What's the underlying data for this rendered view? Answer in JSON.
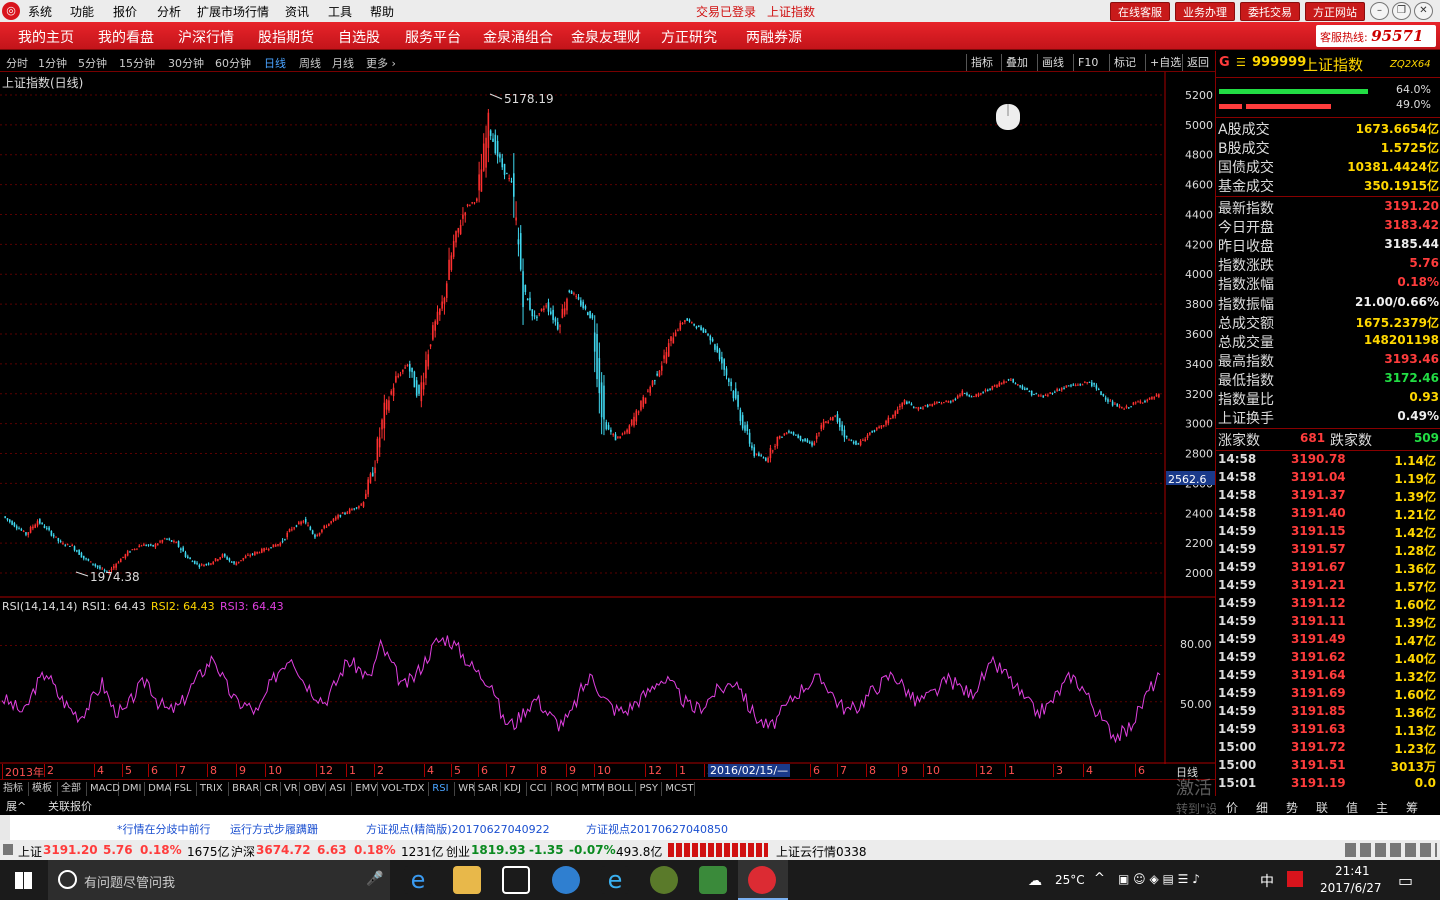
{
  "menubar": {
    "items": [
      "系统",
      "功能",
      "报价",
      "分析",
      "扩展市场行情",
      "资讯",
      "工具",
      "帮助"
    ],
    "status1": "交易已登录",
    "status2": "上证指数",
    "buttons": [
      "在线客服",
      "业务办理",
      "委托交易",
      "方正网站"
    ]
  },
  "navbar": {
    "items": [
      "我的主页",
      "我的看盘",
      "沪深行情",
      "股指期货",
      "自选股",
      "服务平台",
      "金泉涌组合",
      "金泉友理财",
      "方正研究",
      "两融券源"
    ],
    "hotline_label": "客服热线:",
    "hotline_number": "95571"
  },
  "periods": {
    "items": [
      "分时",
      "1分钟",
      "5分钟",
      "15分钟",
      "30分钟",
      "60分钟",
      "日线",
      "周线",
      "月线",
      "更多 ›"
    ],
    "active": "日线"
  },
  "right_tools": [
    "指标",
    "叠加",
    "画线",
    "F10",
    "标记",
    "+自选",
    "返回"
  ],
  "main_chart": {
    "title": "上证指数(日线)",
    "high_label": "5178.19",
    "low_label": "1974.38",
    "y_ticks": [
      "5200",
      "5000",
      "4800",
      "4600",
      "4400",
      "4200",
      "4000",
      "3800",
      "3600",
      "3400",
      "3200",
      "3000",
      "2800",
      "2600",
      "2400",
      "2200",
      "2000"
    ],
    "cursor_value": "2562.6"
  },
  "rsi": {
    "label": "RSI(14,14,14)",
    "rsi1": "RSI1: 64.43",
    "rsi2": "RSI2: 64.43",
    "rsi3": "RSI3: 64.43",
    "ticks": [
      "80.00",
      "50.00"
    ]
  },
  "time_axis": {
    "labels": [
      "2013年",
      "2",
      "4",
      "5",
      "6",
      "7",
      "8",
      "9",
      "10",
      "12",
      "1",
      "2",
      "4",
      "5",
      "6",
      "7",
      "8",
      "9",
      "10",
      "12",
      "1",
      "2",
      "6",
      "7",
      "8",
      "9",
      "10",
      "12",
      "1",
      "3",
      "4",
      "6"
    ],
    "cursor": "2016/02/15/—",
    "right": "日线"
  },
  "indicators": {
    "items": [
      "指标",
      "模板",
      "全部",
      "MACD",
      "DMI",
      "DMA",
      "FSL",
      "TRIX",
      "BRAR",
      "CR",
      "VR",
      "OBV",
      "ASI",
      "EMV",
      "VOL-TDX",
      "RSI",
      "WR",
      "SAR",
      "KDJ",
      "CCI",
      "ROC",
      "MTM",
      "BOLL",
      "PSY",
      "MCST"
    ],
    "active": "RSI",
    "tabs": [
      "展^",
      "关联报价"
    ]
  },
  "panel": {
    "code": "999999",
    "name": "上证指数",
    "tag": "ZQ2X64",
    "bar1_pct": "64.0%",
    "bar2_pct": "49.0%",
    "rows1": [
      {
        "k": "A股成交",
        "v": "1673.6654亿"
      },
      {
        "k": "B股成交",
        "v": "1.5725亿"
      },
      {
        "k": "国债成交",
        "v": "10381.4424亿"
      },
      {
        "k": "基金成交",
        "v": "350.1915亿"
      }
    ],
    "rows2": [
      {
        "k": "最新指数",
        "v": "3191.20",
        "c": "red"
      },
      {
        "k": "今日开盘",
        "v": "3183.42",
        "c": "red"
      },
      {
        "k": "昨日收盘",
        "v": "3185.44",
        "c": "white"
      },
      {
        "k": "指数涨跌",
        "v": "5.76",
        "c": "red"
      },
      {
        "k": "指数涨幅",
        "v": "0.18%",
        "c": "red"
      },
      {
        "k": "指数振幅",
        "v": "21.00/0.66%",
        "c": "white"
      },
      {
        "k": "总成交额",
        "v": "1675.2379亿",
        "c": "yellow"
      },
      {
        "k": "总成交量",
        "v": "148201198",
        "c": "yellow"
      },
      {
        "k": "最高指数",
        "v": "3193.46",
        "c": "red"
      },
      {
        "k": "最低指数",
        "v": "3172.46",
        "c": "green"
      },
      {
        "k": "指数量比",
        "v": "0.93",
        "c": "yellow"
      },
      {
        "k": "上证换手",
        "v": "0.49%",
        "c": "white"
      }
    ],
    "up_label": "涨家数",
    "up": "681",
    "down_label": "跌家数",
    "down": "509",
    "ticks": [
      [
        "14:58",
        "3190.78",
        "1.14亿"
      ],
      [
        "14:58",
        "3191.04",
        "1.19亿"
      ],
      [
        "14:58",
        "3191.37",
        "1.39亿"
      ],
      [
        "14:58",
        "3191.40",
        "1.21亿"
      ],
      [
        "14:59",
        "3191.15",
        "1.42亿"
      ],
      [
        "14:59",
        "3191.57",
        "1.28亿"
      ],
      [
        "14:59",
        "3191.67",
        "1.36亿"
      ],
      [
        "14:59",
        "3191.21",
        "1.57亿"
      ],
      [
        "14:59",
        "3191.12",
        "1.60亿"
      ],
      [
        "14:59",
        "3191.11",
        "1.39亿"
      ],
      [
        "14:59",
        "3191.49",
        "1.47亿"
      ],
      [
        "14:59",
        "3191.62",
        "1.40亿"
      ],
      [
        "14:59",
        "3191.64",
        "1.32亿"
      ],
      [
        "14:59",
        "3191.69",
        "1.60亿"
      ],
      [
        "14:59",
        "3191.85",
        "1.36亿"
      ],
      [
        "14:59",
        "3191.63",
        "1.13亿"
      ],
      [
        "15:00",
        "3191.72",
        "1.23亿"
      ],
      [
        "15:00",
        "3191.51",
        "3013万"
      ],
      [
        "15:01",
        "3191.19",
        "0.0"
      ]
    ],
    "bottom_tabs": [
      "价",
      "细",
      "势",
      "联",
      "值",
      "主",
      "筹"
    ]
  },
  "watermark": {
    "line1": "激活 Windows",
    "line2": "转到\"设置\"以激活 Windows。"
  },
  "news": [
    "*行情在分歧中前行",
    "运行方式步履蹒跚",
    "方证视点(精简版)20170627040922",
    "方证视点20170627040850"
  ],
  "ticker": [
    {
      "name": "上证",
      "price": "3191.20",
      "chg": "5.76",
      "pct": "0.18%",
      "amt": "1675亿"
    },
    {
      "name": "沪深",
      "price": "3674.72",
      "chg": "6.63",
      "pct": "0.18%",
      "amt": "1231亿"
    },
    {
      "name": "创业",
      "price": "1819.93",
      "chg": "-1.35",
      "pct": "-0.07%",
      "amt": "493.8亿"
    }
  ],
  "ticker_extra": "上证云行情0338",
  "taskbar": {
    "search_placeholder": "有问题尽管问我",
    "weather": "25°C",
    "ime": "中",
    "time": "21:41",
    "date": "2017/6/27"
  },
  "chart_data": [
    {
      "type": "candlestick",
      "title": "上证指数(日线)",
      "ylim": [
        1900,
        5300
      ],
      "y_ticks": [
        2000,
        2200,
        2400,
        2600,
        2800,
        3000,
        3200,
        3400,
        3600,
        3800,
        4000,
        4200,
        4400,
        4600,
        4800,
        5000,
        5200
      ],
      "close": [
        2380,
        2320,
        2260,
        2350,
        2280,
        2200,
        2180,
        2100,
        2050,
        2000,
        2080,
        2150,
        2190,
        2180,
        2230,
        2200,
        2100,
        2050,
        2070,
        2120,
        2060,
        2110,
        2140,
        2170,
        2200,
        2300,
        2350,
        2250,
        2320,
        2380,
        2420,
        2460,
        2680,
        3080,
        3300,
        3400,
        3180,
        3580,
        3800,
        4200,
        4450,
        4500,
        5000,
        4750,
        4600,
        3900,
        3700,
        3800,
        3650,
        3900,
        3800,
        3700,
        3000,
        2900,
        2950,
        3100,
        3250,
        3400,
        3600,
        3700,
        3650,
        3600,
        3450,
        3250,
        3000,
        2800,
        2760,
        2900,
        2950,
        2900,
        2860,
        3000,
        3050,
        2900,
        2860,
        2940,
        2980,
        3060,
        3150,
        3100,
        3120,
        3140,
        3150,
        3210,
        3180,
        3220,
        3260,
        3300,
        3250,
        3200,
        3180,
        3220,
        3250,
        3260,
        3280,
        3200,
        3130,
        3100,
        3140,
        3160,
        3191.2
      ]
    },
    {
      "type": "line",
      "name": "RSI",
      "ylim": [
        20,
        100
      ],
      "ticks": [
        50,
        80
      ],
      "values": [
        52,
        48,
        44,
        58,
        66,
        54,
        47,
        42,
        50,
        60,
        46,
        44,
        55,
        62,
        50,
        45,
        48,
        58,
        66,
        74,
        60,
        50,
        48,
        44,
        58,
        68,
        75,
        62,
        55,
        50,
        60,
        72,
        68,
        62,
        80,
        70,
        58,
        63,
        72,
        82,
        84,
        78,
        70,
        64,
        60,
        40,
        38,
        46,
        52,
        44,
        38,
        42,
        56,
        64,
        52,
        46,
        45,
        50,
        55,
        62,
        60,
        52,
        46,
        48,
        55,
        58,
        62,
        48,
        40,
        36,
        44,
        52,
        58,
        62,
        60,
        50,
        45,
        48,
        55,
        60,
        65,
        58,
        50,
        52,
        56,
        62,
        58,
        54,
        62,
        70,
        66,
        58,
        50,
        44,
        48,
        56,
        64,
        58,
        48,
        38,
        32,
        34,
        44,
        56,
        64.43
      ]
    }
  ]
}
